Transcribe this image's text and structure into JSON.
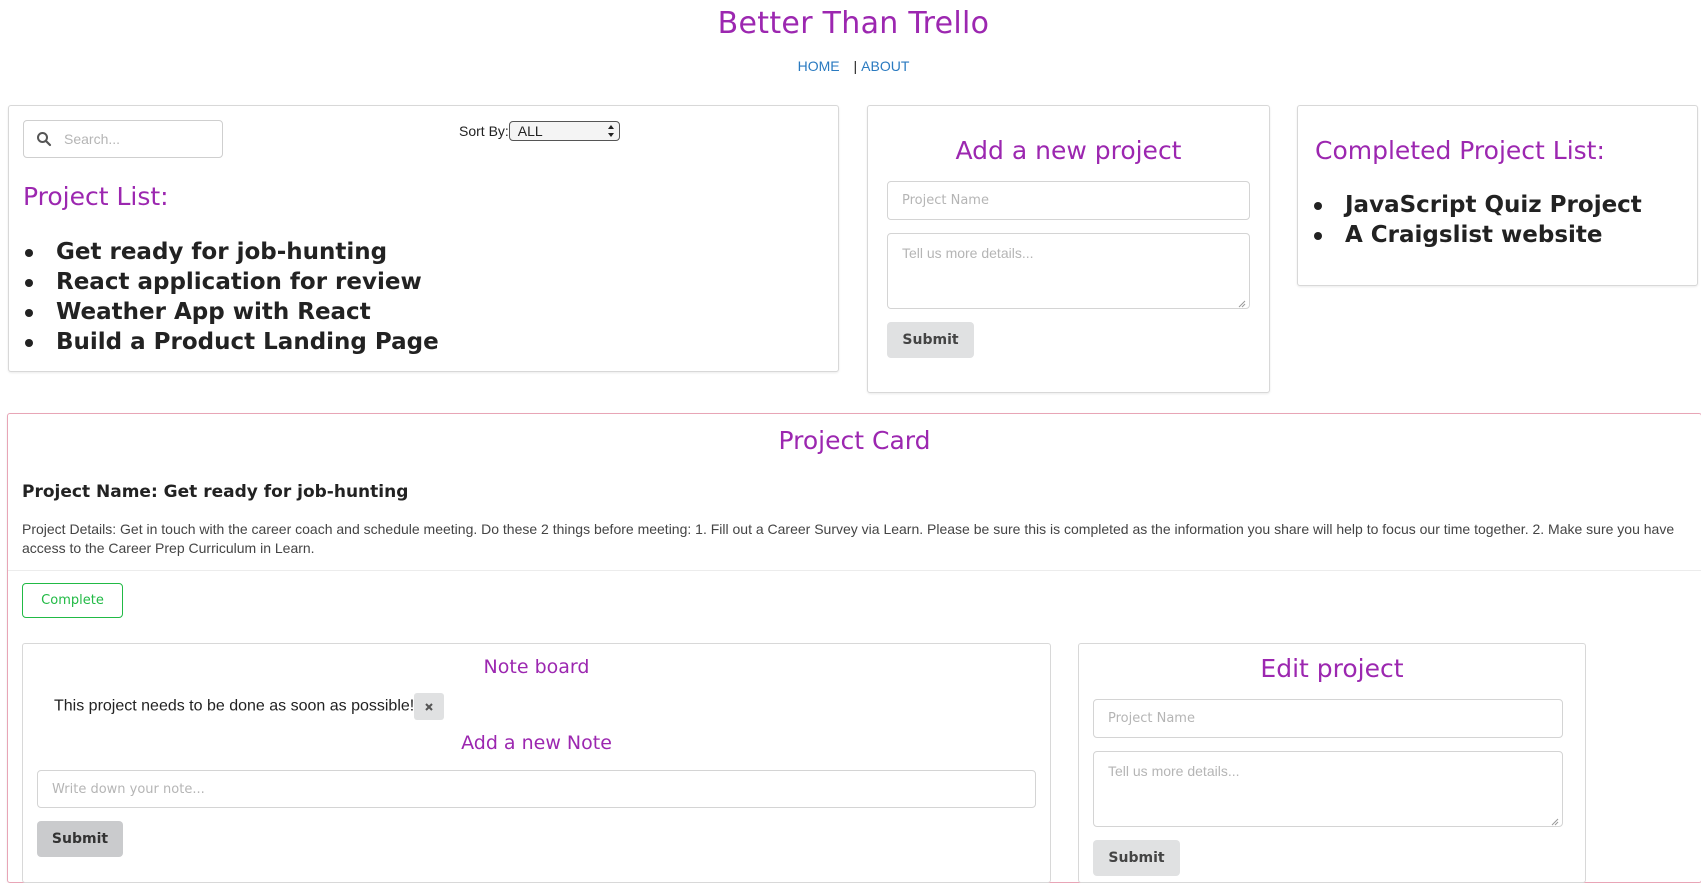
{
  "site": {
    "title": "Better Than Trello",
    "nav": {
      "home": "HOME",
      "separator": "|",
      "about": "ABOUT"
    }
  },
  "project_list_panel": {
    "search_placeholder": "Search...",
    "sort_label": "Sort By:",
    "sort_value": "ALL",
    "heading": "Project List:",
    "items": [
      "Get ready for job-hunting",
      "React application for review",
      "Weather App with React",
      "Build a Product Landing Page"
    ]
  },
  "add_project_panel": {
    "heading": "Add a new project",
    "name_placeholder": "Project Name",
    "details_placeholder": "Tell us more details...",
    "submit_label": "Submit"
  },
  "completed_panel": {
    "heading": "Completed Project List:",
    "items": [
      "JavaScript Quiz Project",
      "A Craigslist website"
    ]
  },
  "project_card": {
    "heading": "Project Card",
    "name": "Project Name: Get ready for job-hunting",
    "details": "Project Details: Get in touch with the career coach and schedule meeting. Do these 2 things before meeting: 1. Fill out a Career Survey via Learn. Please be sure this is completed as the information you share will help to focus our time together. 2. Make sure you have access to the Career Prep Curriculum in Learn.",
    "complete_label": "Complete",
    "note_board": {
      "heading": "Note board",
      "notes": [
        "This project needs to be done as soon as possible!"
      ],
      "add_heading": "Add a new Note",
      "note_placeholder": "Write down your note...",
      "submit_label": "Submit"
    },
    "edit_project": {
      "heading": "Edit project",
      "name_placeholder": "Project Name",
      "details_placeholder": "Tell us more details...",
      "submit_label": "Submit"
    }
  },
  "colors": {
    "accent": "#9c27b0",
    "link": "#2a7ac0",
    "complete": "#21ba45",
    "card_border": "#e8a5b6"
  },
  "icons": {
    "search": "search-icon",
    "sort_arrows": "select-arrows-icon",
    "delete_note": "close-icon",
    "bullet": "bullet-icon",
    "resize": "resize-grip-icon"
  }
}
